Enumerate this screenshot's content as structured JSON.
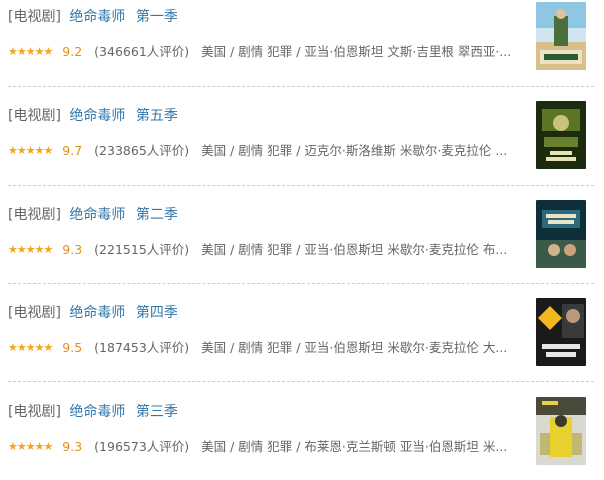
{
  "results": [
    {
      "category": "[电视剧]",
      "title": "绝命毒师",
      "season": "第一季",
      "stars": "★★★★★",
      "rating": "9.2",
      "count": "(346661人评价)",
      "abstract": "美国 / 剧情 犯罪 / 亚当·伯恩斯坦 文斯·吉里根 翠西亚·..."
    },
    {
      "category": "[电视剧]",
      "title": "绝命毒师",
      "season": "第五季",
      "stars": "★★★★★",
      "rating": "9.7",
      "count": "(233865人评价)",
      "abstract": "美国 / 剧情 犯罪 / 迈克尔·斯洛维斯 米歇尔·麦克拉伦 ..."
    },
    {
      "category": "[电视剧]",
      "title": "绝命毒师",
      "season": "第二季",
      "stars": "★★★★★",
      "rating": "9.3",
      "count": "(221515人评价)",
      "abstract": "美国 / 剧情 犯罪 / 亚当·伯恩斯坦 米歇尔·麦克拉伦 布..."
    },
    {
      "category": "[电视剧]",
      "title": "绝命毒师",
      "season": "第四季",
      "stars": "★★★★★",
      "rating": "9.5",
      "count": "(187453人评价)",
      "abstract": "美国 / 剧情 犯罪 / 亚当·伯恩斯坦 米歇尔·麦克拉伦 大..."
    },
    {
      "category": "[电视剧]",
      "title": "绝命毒师",
      "season": "第三季",
      "stars": "★★★★★",
      "rating": "9.3",
      "count": "(196573人评价)",
      "abstract": "美国 / 剧情 犯罪 / 布莱恩·克兰斯顿 亚当·伯恩斯坦 米..."
    }
  ],
  "colors": {
    "link": "#3377aa",
    "star": "#f4a51c",
    "rating": "#e09015",
    "text": "#666666"
  }
}
